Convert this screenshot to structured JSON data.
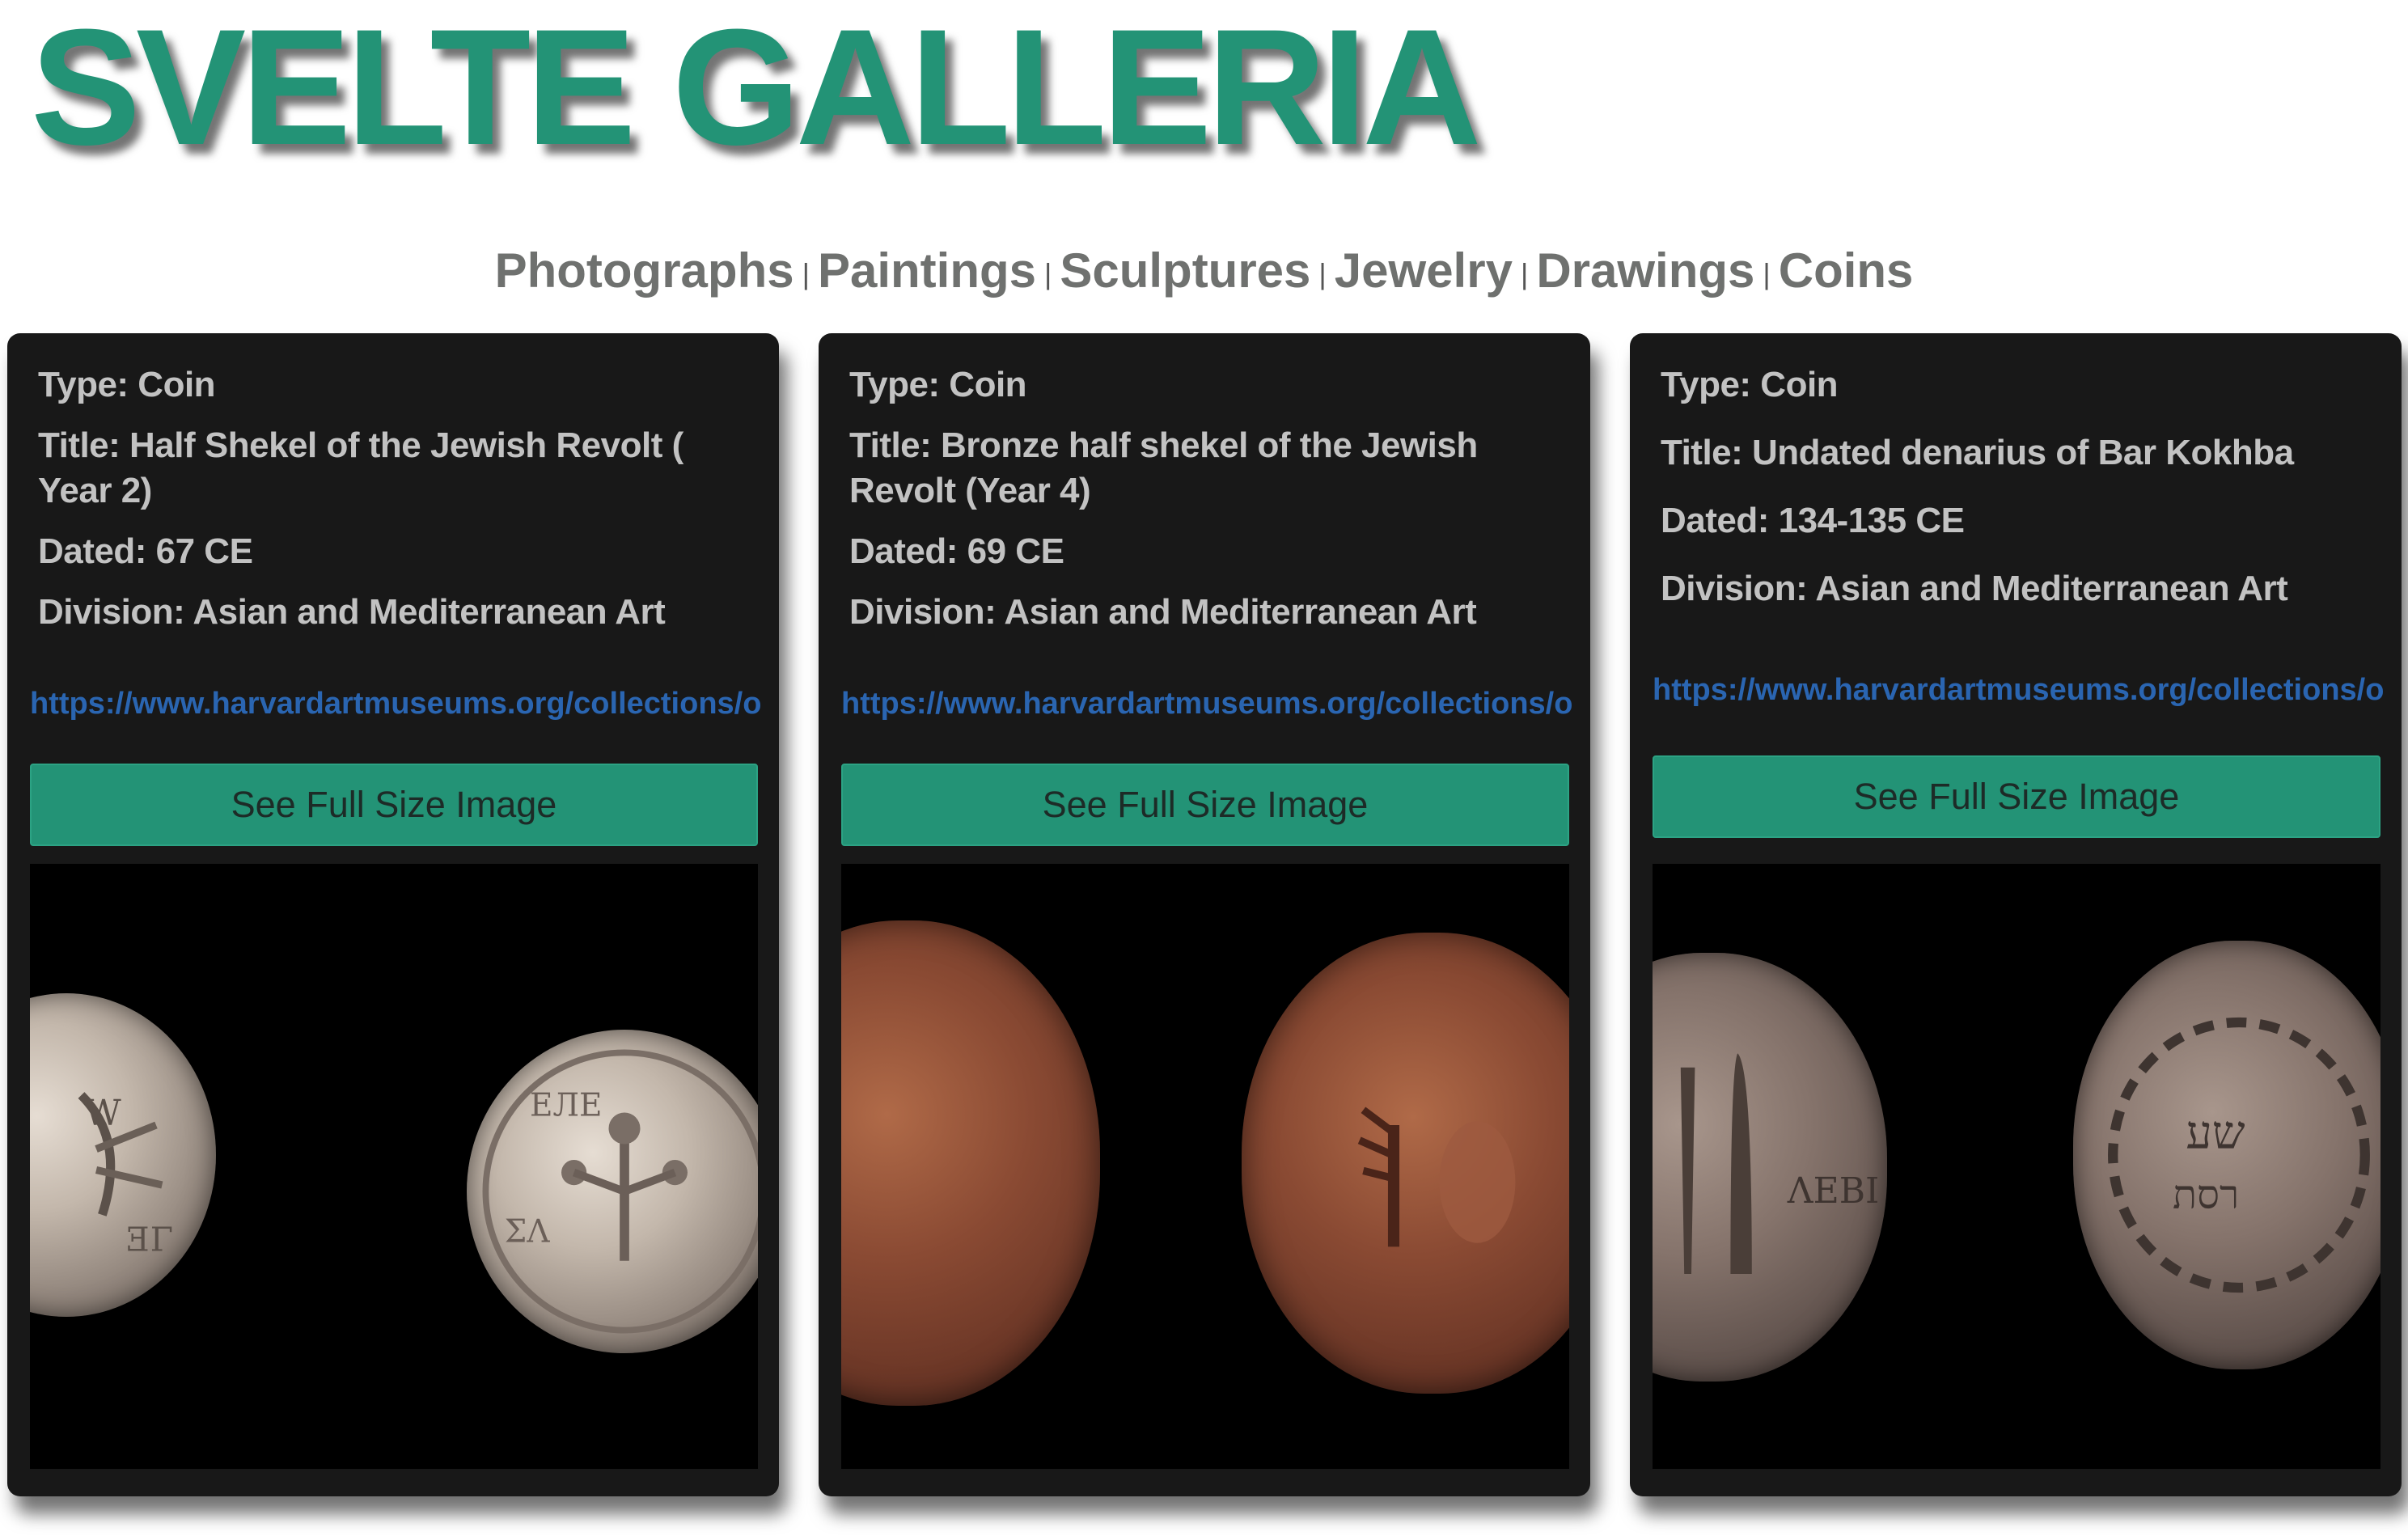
{
  "site": {
    "title": "SVELTE GALLERIA"
  },
  "nav": {
    "items": [
      "Photographs",
      "Paintings",
      "Sculptures",
      "Jewelry",
      "Drawings",
      "Coins"
    ],
    "separator": "|"
  },
  "cards": [
    {
      "type": "Type: Coin",
      "title": "Title: Half Shekel of the Jewish Revolt ( Year 2)",
      "dated": "Dated: 67 CE",
      "division": "Division: Asian and Mediterranean Art",
      "link": "https://www.harvardartmuseums.org/collections/object/",
      "button": "See Full Size Image",
      "image": {
        "coin_color": "silver"
      }
    },
    {
      "type": "Type: Coin",
      "title": "Title: Bronze half shekel of the Jewish Revolt (Year 4)",
      "dated": "Dated: 69 CE",
      "division": "Division: Asian and Mediterranean Art",
      "link": "https://www.harvardartmuseums.org/collections/object/",
      "button": "See Full Size Image",
      "image": {
        "coin_color": "bronze"
      }
    },
    {
      "type": "Type: Coin",
      "title": "Title: Undated denarius of Bar Kokhba",
      "dated": "Dated: 134-135 CE",
      "division": "Division: Asian and Mediterranean Art",
      "link": "https://www.harvardartmuseums.org/collections/object/",
      "button": "See Full Size Image",
      "image": {
        "coin_color": "silver-dark"
      }
    }
  ],
  "colors": {
    "accent": "#239376",
    "nav_text": "#6f716f",
    "card_bg": "#181818",
    "card_text": "#c2c2c2",
    "link": "#2a65b1"
  }
}
